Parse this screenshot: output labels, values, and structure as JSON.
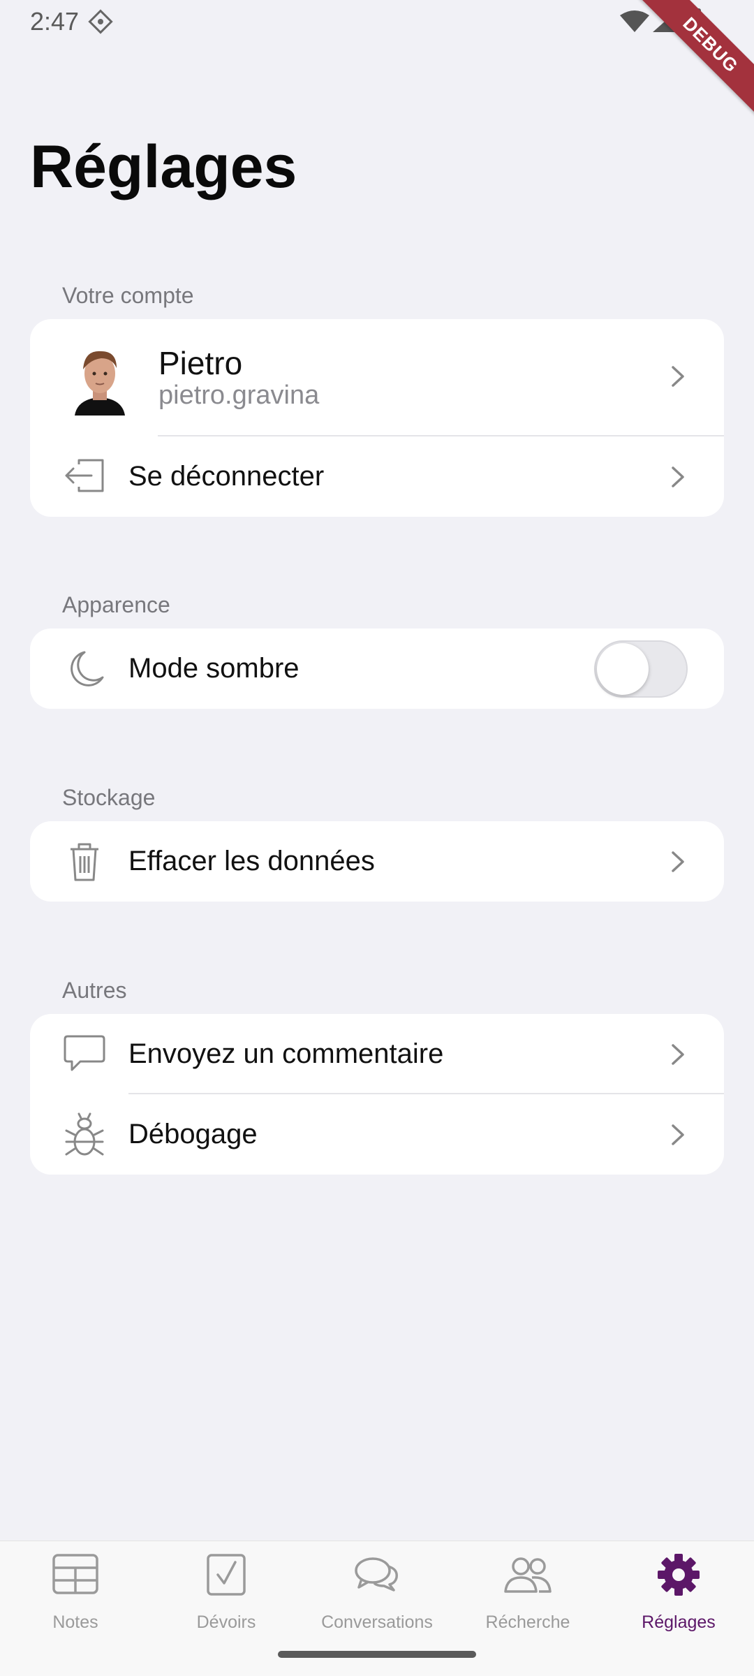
{
  "status_bar": {
    "time": "2:47"
  },
  "debug_ribbon": "DEBUG",
  "page": {
    "title": "Réglages"
  },
  "sections": {
    "account": {
      "label": "Votre compte",
      "profile_name": "Pietro",
      "profile_handle": "pietro.gravina",
      "logout_label": "Se déconnecter"
    },
    "appearance": {
      "label": "Apparence",
      "dark_mode_label": "Mode sombre",
      "dark_mode_enabled": false
    },
    "storage": {
      "label": "Stockage",
      "clear_data_label": "Effacer les données"
    },
    "others": {
      "label": "Autres",
      "feedback_label": "Envoyez un commentaire",
      "debug_label": "Débogage"
    }
  },
  "bottom_nav": {
    "items": [
      {
        "label": "Notes",
        "icon": "grid-table-icon"
      },
      {
        "label": "Dévoirs",
        "icon": "checkbox-icon"
      },
      {
        "label": "Conversations",
        "icon": "chat-bubbles-icon"
      },
      {
        "label": "Récherche",
        "icon": "people-icon"
      },
      {
        "label": "Réglages",
        "icon": "gear-icon"
      }
    ],
    "active_index": 4,
    "active_color": "#5c1768",
    "inactive_color": "#9a9a9a"
  }
}
